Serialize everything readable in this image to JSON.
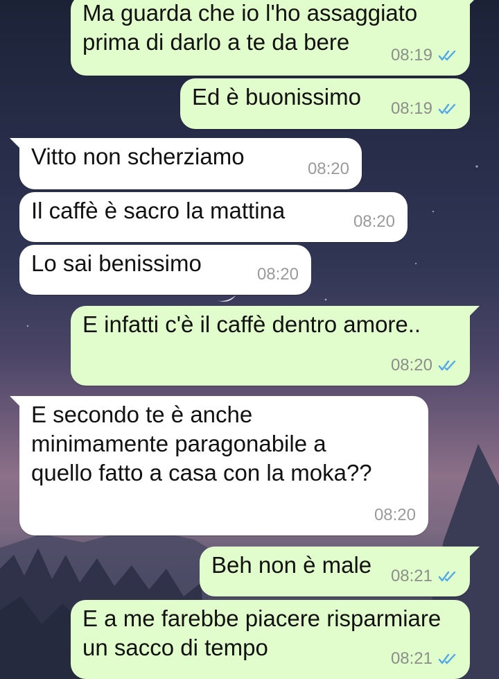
{
  "messages": [
    {
      "text": "Ma guarda che io l'ho assaggiato\nprima di darlo a te da bere",
      "time": "08:19",
      "direction": "outgoing",
      "read": true
    },
    {
      "text": "Ed è buonissimo",
      "time": "08:19",
      "direction": "outgoing",
      "read": true
    },
    {
      "text": "Vitto non scherziamo",
      "time": "08:20",
      "direction": "incoming"
    },
    {
      "text": "Il caffè è sacro la mattina",
      "time": "08:20",
      "direction": "incoming"
    },
    {
      "text": "Lo sai benissimo",
      "time": "08:20",
      "direction": "incoming"
    },
    {
      "text": "E infatti c'è il caffè dentro amore..",
      "time": "08:20",
      "direction": "outgoing",
      "read": true
    },
    {
      "text": "E secondo te è anche\nminimamente paragonabile a\nquello fatto a casa con la moka??",
      "time": "08:20",
      "direction": "incoming"
    },
    {
      "text": "Beh non è male",
      "time": "08:21",
      "direction": "outgoing",
      "read": true
    },
    {
      "text": "E a me farebbe piacere risparmiare\nun sacco di tempo",
      "time": "08:21",
      "direction": "outgoing",
      "read": true
    }
  ],
  "colors": {
    "outgoing_bubble": "#e2fdcc",
    "incoming_bubble": "#ffffff",
    "read_ticks": "#4fa8e8"
  },
  "icons": {
    "read_receipt": "double-check-icon"
  }
}
